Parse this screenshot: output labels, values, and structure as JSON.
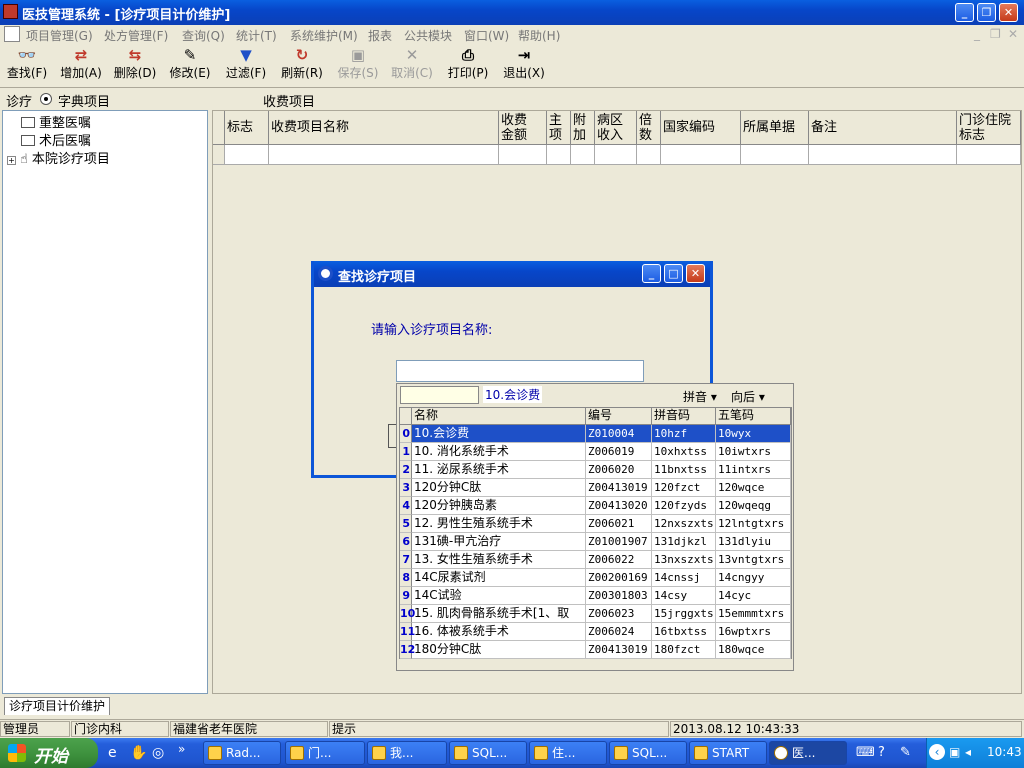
{
  "window": {
    "title": "医技管理系统 - [诊疗项目计价维护]"
  },
  "menu": [
    "项目管理(G)",
    "处方管理(F)",
    "查询(Q)",
    "统计(T)",
    "系统维护(M)",
    "报表",
    "公共模块",
    "窗口(W)",
    "帮助(H)"
  ],
  "toolbar": [
    {
      "label": "查找(F)",
      "icon": "binoculars-icon",
      "glyph": "👓",
      "enabled": true
    },
    {
      "label": "增加(A)",
      "icon": "add-icon",
      "glyph": "⇄",
      "enabled": true
    },
    {
      "label": "删除(D)",
      "icon": "delete-icon",
      "glyph": "⇆",
      "enabled": true
    },
    {
      "label": "修改(E)",
      "icon": "edit-icon",
      "glyph": "✎",
      "enabled": true
    },
    {
      "label": "过滤(F)",
      "icon": "filter-icon",
      "glyph": "▼",
      "enabled": true
    },
    {
      "label": "刷新(R)",
      "icon": "refresh-icon",
      "glyph": "↻",
      "enabled": true
    },
    {
      "label": "保存(S)",
      "icon": "save-icon",
      "glyph": "▣",
      "enabled": false
    },
    {
      "label": "取消(C)",
      "icon": "cancel-icon",
      "glyph": "✕",
      "enabled": false
    },
    {
      "label": "打印(P)",
      "icon": "print-icon",
      "glyph": "⎙",
      "enabled": true
    },
    {
      "label": "退出(X)",
      "icon": "exit-icon",
      "glyph": "⇥",
      "enabled": true
    }
  ],
  "panel": {
    "radio1": "诊疗",
    "radio2": "字典项目",
    "grid_title": "收费项目"
  },
  "tree": [
    {
      "label": "重整医嘱",
      "icon": "folder-icon"
    },
    {
      "label": "术后医嘱",
      "icon": "folder-icon"
    },
    {
      "label": "本院诊疗项目",
      "icon": "hand-icon",
      "expandable": true
    }
  ],
  "grid": {
    "columns": [
      "标志",
      "收费项目名称",
      "收费\n金额",
      "主\n项",
      "附\n加",
      "病区\n收入",
      "倍\n数",
      "国家编码",
      "所属单据",
      "备注",
      "门诊住院\n标志"
    ]
  },
  "dialog": {
    "title": "查找诊疗项目",
    "prompt": "请输入诊疗项目名称:",
    "input_value": ""
  },
  "popup": {
    "filter_value": "",
    "current": "10.会诊费",
    "mode": "拼音",
    "direction": "向后",
    "columns": [
      "名称",
      "编号",
      "拼音码",
      "五笔码"
    ],
    "rows": [
      {
        "i": "0",
        "name": "10.会诊费",
        "code": "Z010004",
        "py": "10hzf",
        "wb": "10wyx"
      },
      {
        "i": "1",
        "name": "10. 消化系统手术",
        "code": "Z006019",
        "py": "10xhxtss",
        "wb": "10iwtxrs"
      },
      {
        "i": "2",
        "name": "11. 泌尿系统手术",
        "code": "Z006020",
        "py": "11bnxtss",
        "wb": "11intxrs"
      },
      {
        "i": "3",
        "name": "120分钟C肽",
        "code": "Z00413019",
        "py": "120fzct",
        "wb": "120wqce"
      },
      {
        "i": "4",
        "name": "120分钟胰岛素",
        "code": "Z00413020",
        "py": "120fzyds",
        "wb": "120wqeqg"
      },
      {
        "i": "5",
        "name": "12. 男性生殖系统手术",
        "code": "Z006021",
        "py": "12nxszxts",
        "wb": "12lntgtxrs"
      },
      {
        "i": "6",
        "name": "131碘-甲亢治疗",
        "code": "Z01001907",
        "py": "131djkzl",
        "wb": "131dlyiu"
      },
      {
        "i": "7",
        "name": "13. 女性生殖系统手术",
        "code": "Z006022",
        "py": "13nxszxts",
        "wb": "13vntgtxrs"
      },
      {
        "i": "8",
        "name": "14C尿素试剂",
        "code": "Z00200169",
        "py": "14cnssj",
        "wb": "14cngyy"
      },
      {
        "i": "9",
        "name": "14C试验",
        "code": "Z00301803",
        "py": "14csy",
        "wb": "14cyc"
      },
      {
        "i": "10",
        "name": "15. 肌肉骨骼系统手术[1、取",
        "code": "Z006023",
        "py": "15jrggxts",
        "wb": "15emmmtxrs"
      },
      {
        "i": "11",
        "name": "16. 体被系统手术",
        "code": "Z006024",
        "py": "16tbxtss",
        "wb": "16wptxrs"
      },
      {
        "i": "12",
        "name": "180分钟C肽",
        "code": "Z00413019",
        "py": "180fzct",
        "wb": "180wqce"
      }
    ]
  },
  "tab": "诊疗项目计价维护",
  "status": [
    "管理员",
    "门诊内科",
    "福建省老年医院",
    "提示",
    "2013.08.12 10:43:33"
  ],
  "taskbar": {
    "start": "开始",
    "items": [
      "Rad...",
      "门...",
      "我...",
      "SQL...",
      "住...",
      "SQL...",
      "START",
      "医..."
    ],
    "clock": "10:43"
  }
}
